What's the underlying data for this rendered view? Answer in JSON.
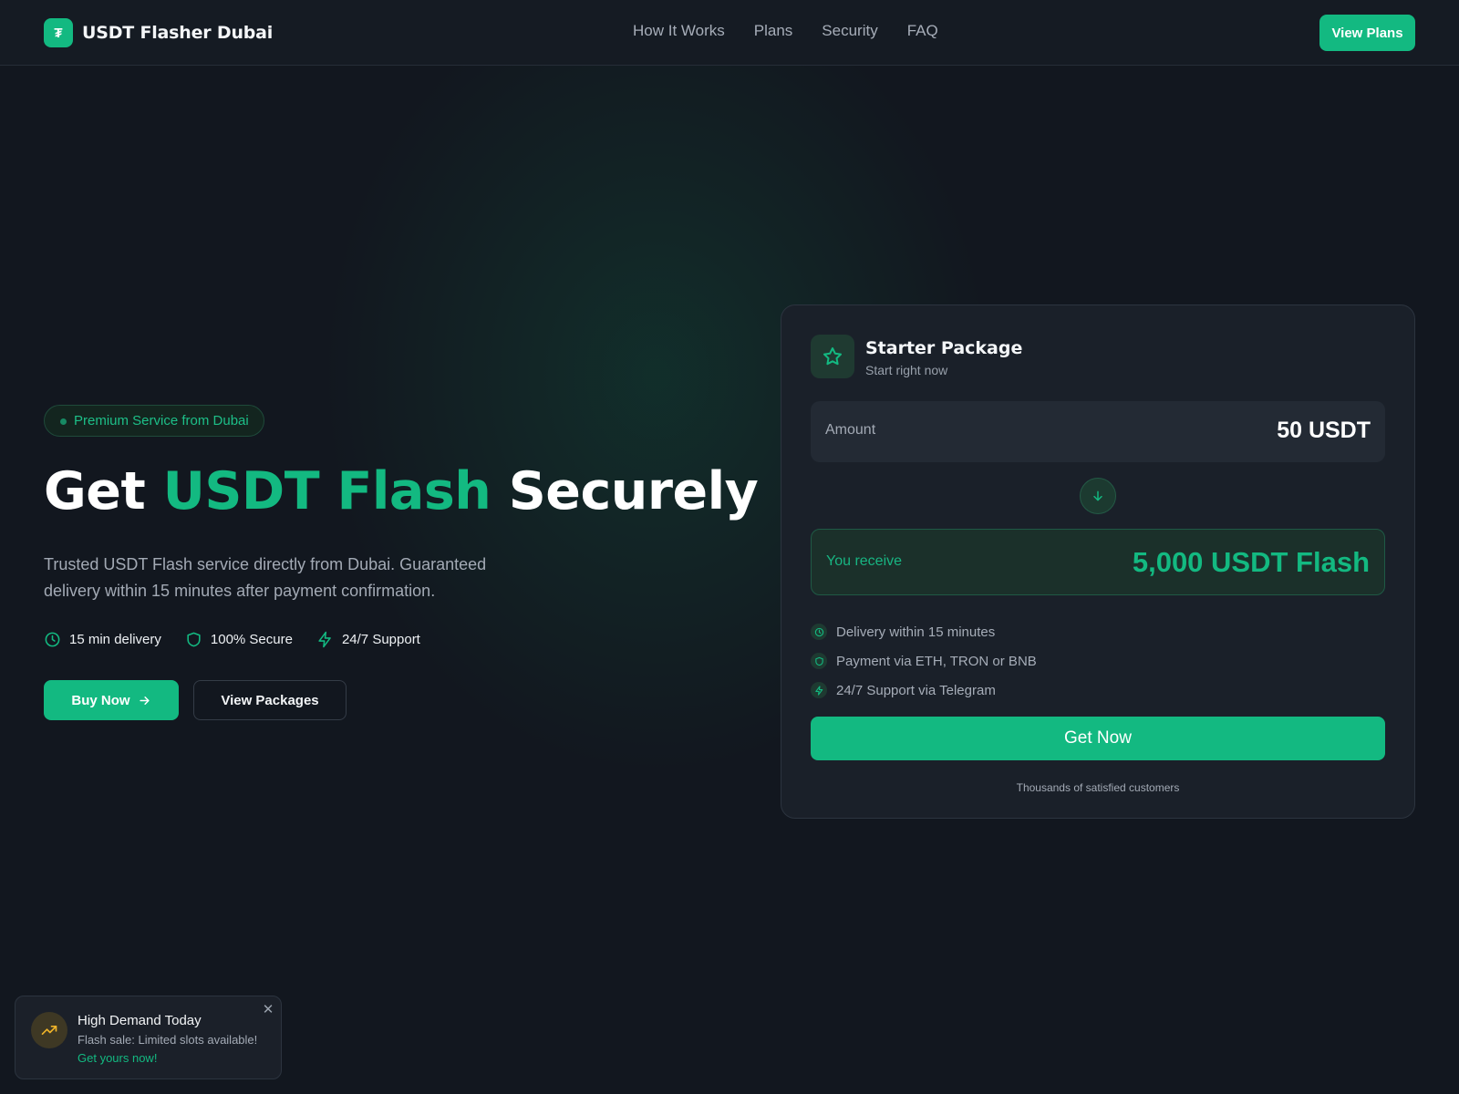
{
  "brand": {
    "name": "USDT Flasher Dubai",
    "logo_glyph": "₮",
    "accent": "#13b981"
  },
  "nav": {
    "items": [
      "How It Works",
      "Plans",
      "Security",
      "FAQ"
    ],
    "cta": "View Plans"
  },
  "hero": {
    "badge": "Premium Service from Dubai",
    "headline_part1": "Get",
    "headline_accent": "USDT Flash",
    "headline_part2": "Securely",
    "subtext": "Trusted USDT Flash service directly from Dubai. Guaranteed delivery within 15 minutes after payment confirmation.",
    "features": [
      {
        "icon": "clock-icon",
        "label": "15 min delivery"
      },
      {
        "icon": "shield-icon",
        "label": "100% Secure"
      },
      {
        "icon": "lightning-icon",
        "label": "24/7 Support"
      }
    ],
    "buy_label": "Buy Now",
    "packages_label": "View Packages"
  },
  "card": {
    "title": "Starter Package",
    "subtitle": "Start right now",
    "amount_label": "Amount",
    "amount_value": "50 USDT",
    "receive_label": "You receive",
    "receive_value": "5,000 USDT Flash",
    "list": [
      {
        "icon": "clock-icon",
        "label": "Delivery within 15 minutes"
      },
      {
        "icon": "shield-icon",
        "label": "Payment via ETH, TRON or BNB"
      },
      {
        "icon": "lightning-icon",
        "label": "24/7 Support via Telegram"
      }
    ],
    "cta": "Get Now",
    "footer": "Thousands of satisfied customers"
  },
  "toast": {
    "title": "High Demand Today",
    "text": "Flash sale: Limited slots available!",
    "link": "Get yours now!",
    "icon": "trending-up-icon",
    "close": "✕"
  }
}
